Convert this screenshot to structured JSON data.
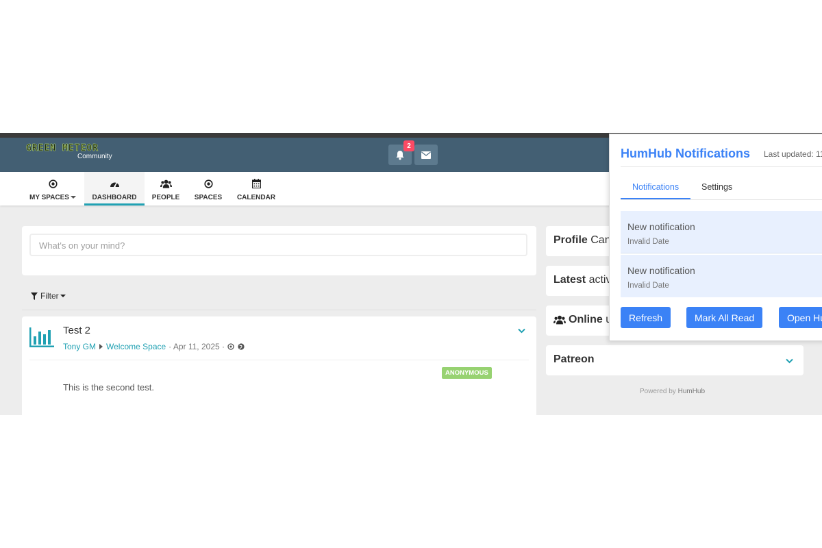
{
  "app": {
    "logo_title": "GREEN METEOR",
    "logo_subtitle": "Community",
    "notification_count": "2"
  },
  "nav": [
    {
      "label": "MY SPACES",
      "icon": "dot-circle-icon"
    },
    {
      "label": "DASHBOARD",
      "icon": "dashboard-icon"
    },
    {
      "label": "PEOPLE",
      "icon": "users-icon"
    },
    {
      "label": "SPACES",
      "icon": "dot-circle-icon"
    },
    {
      "label": "CALENDAR",
      "icon": "calendar-icon"
    }
  ],
  "composer": {
    "placeholder": "What's on your mind?"
  },
  "filter": {
    "label": "Filter"
  },
  "post": {
    "title": "Test 2",
    "author": "Tony GM",
    "space": "Welcome Space",
    "date": "· Apr 11, 2025 ·",
    "badge": "ANONYMOUS",
    "body": "This is the second test."
  },
  "sidebar": {
    "profile_bold": "Profile",
    "profile_light": "Can",
    "latest_bold": "Latest",
    "latest_light": "activ",
    "online_bold": "Online",
    "online_light": "u",
    "patreon": "Patreon",
    "powered_prefix": "Powered by",
    "powered_brand": "HumHub"
  },
  "notifications_popup": {
    "title": "HumHub Notifications",
    "last_updated": "Last updated: 11",
    "tabs": [
      "Notifications",
      "Settings"
    ],
    "items": [
      {
        "title": "New notification",
        "date": "Invalid Date"
      },
      {
        "title": "New notification",
        "date": "Invalid Date"
      }
    ],
    "buttons": {
      "refresh": "Refresh",
      "mark_all_read": "Mark All Read",
      "open": "Open Hu"
    }
  },
  "colors": {
    "topbar": "#435f73",
    "accent": "#21a1b3",
    "popup_accent": "#3b82f6",
    "badge": "#fc4a64",
    "anonymous_badge": "#97d271"
  }
}
